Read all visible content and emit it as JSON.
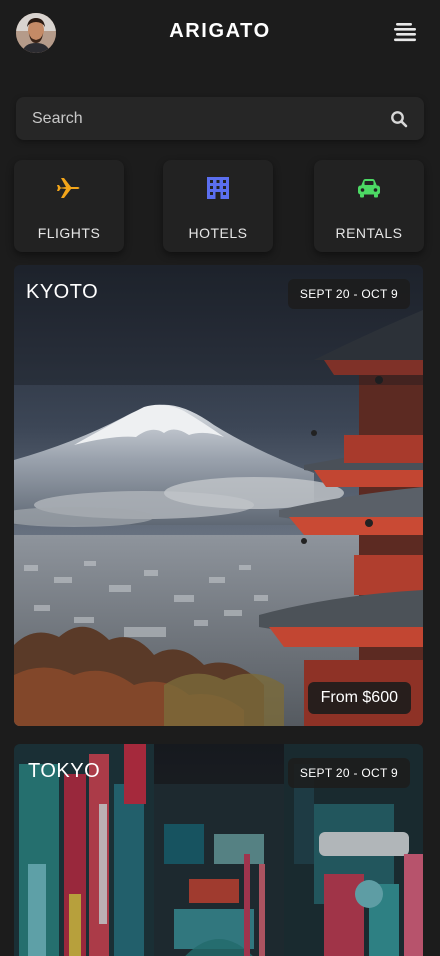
{
  "header": {
    "title": "ARIGATO",
    "avatar_icon": "user-avatar",
    "menu_icon": "menu-icon"
  },
  "search": {
    "placeholder": "Search",
    "icon": "search-icon"
  },
  "categories": [
    {
      "label": "FLIGHTS",
      "icon": "airplane-icon",
      "color": "#f2a51a"
    },
    {
      "label": "HOTELS",
      "icon": "hotel-icon",
      "color": "#5b6ff0"
    },
    {
      "label": "RENTALS",
      "icon": "car-icon",
      "color": "#4cd964"
    }
  ],
  "destinations": [
    {
      "city": "KYOTO",
      "dates": "SEPT 20 - OCT 9",
      "price": "From $600"
    },
    {
      "city": "TOKYO",
      "dates": "SEPT 20 - OCT 9"
    }
  ],
  "colors": {
    "background": "#1c1c1c",
    "surface": "#262626"
  }
}
